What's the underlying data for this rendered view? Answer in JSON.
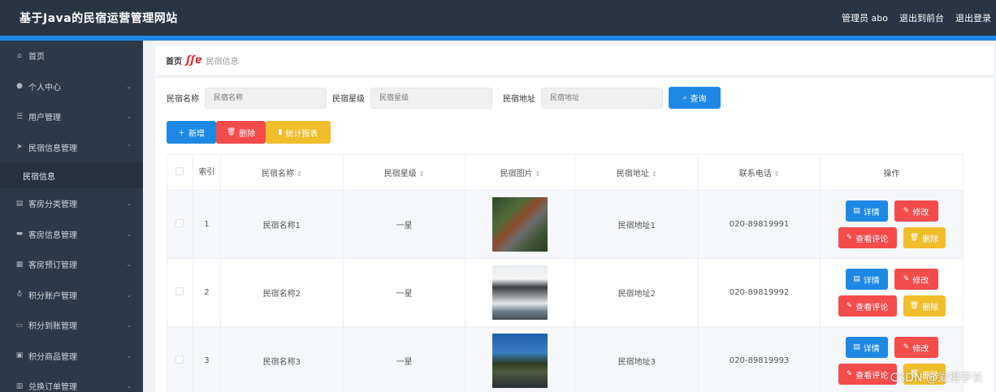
{
  "header": {
    "title": "基于Java的民宿运营管理网站",
    "admin_label": "管理员 abo",
    "back_to_front": "退出到前台",
    "logout": "退出登录"
  },
  "colors": {
    "header_bg": "#2a3543",
    "accent": "#1e88e5",
    "sidebar_bg": "#2b3a4a",
    "danger": "#f44b4b",
    "warning": "#f0bd2b"
  },
  "sidebar": {
    "items": [
      {
        "label": "首页",
        "icon": "home-icon"
      },
      {
        "label": "个人中心",
        "icon": "user-icon"
      },
      {
        "label": "用户管理",
        "icon": "list-icon"
      },
      {
        "label": "民宿信息管理",
        "icon": "send-icon"
      },
      {
        "label": "客房分类管理",
        "icon": "bank-icon"
      },
      {
        "label": "客房信息管理",
        "icon": "card-icon"
      },
      {
        "label": "客房预订管理",
        "icon": "grid-icon"
      },
      {
        "label": "积分账户管理",
        "icon": "mic-icon"
      },
      {
        "label": "积分到账管理",
        "icon": "wallet-icon"
      },
      {
        "label": "积分商品管理",
        "icon": "image-icon"
      },
      {
        "label": "兑换订单管理",
        "icon": "table-icon"
      }
    ],
    "sub_item": "民宿信息"
  },
  "breadcrumb": {
    "home": "首页",
    "separator": "ʃʃɐ",
    "current": "民宿信息"
  },
  "search": {
    "name_label": "民宿名称",
    "name_placeholder": "民宿名称",
    "star_label": "民宿星级",
    "star_placeholder": "民宿星级",
    "addr_label": "民宿地址",
    "addr_placeholder": "民宿地址",
    "query": "查询"
  },
  "actions": {
    "add": "新增",
    "delete": "删除",
    "report": "统计报表"
  },
  "table": {
    "headers": [
      "索引",
      "民宿名称",
      "民宿星级",
      "民宿图片",
      "民宿地址",
      "联系电话",
      "操作"
    ],
    "rows": [
      {
        "index": "1",
        "name": "民宿名称1",
        "star": "一星",
        "address": "民宿地址1",
        "phone": "020-89819991"
      },
      {
        "index": "2",
        "name": "民宿名称2",
        "star": "一星",
        "address": "民宿地址2",
        "phone": "020-89819992"
      },
      {
        "index": "3",
        "name": "民宿名称3",
        "star": "一星",
        "address": "民宿地址3",
        "phone": "020-89819993"
      }
    ],
    "ops": {
      "detail": "详情",
      "edit": "修改",
      "comments": "查看评论",
      "delete": "删除"
    }
  },
  "watermark": "CSDN @爱得学长"
}
